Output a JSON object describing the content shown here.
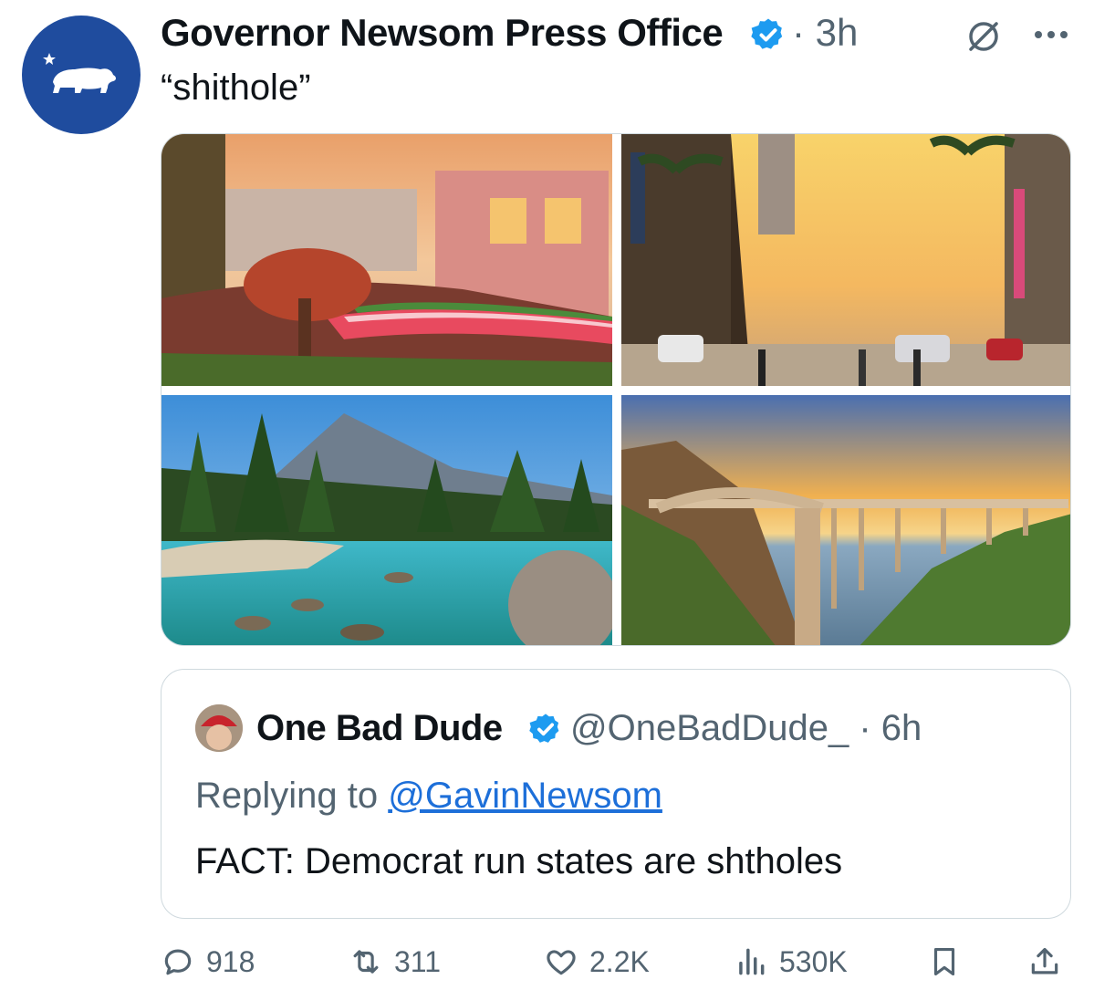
{
  "post": {
    "author_name": "Governor Newsom Press Office",
    "time": "· 3h",
    "text": "“shithole”"
  },
  "quoted_post": {
    "author_name": "One Bad Dude",
    "handle_time": "@OneBadDude_ · 6h",
    "replying_prefix": "Replying to ",
    "replying_to": "@GavinNewsom",
    "text": "FACT: Democrat run states are shtholes"
  },
  "actions": {
    "replies": "918",
    "reposts": "311",
    "likes": "2.2K",
    "views": "530K"
  },
  "icons": [
    "verified-badge-icon",
    "grok-icon",
    "more-icon",
    "reply-icon",
    "repost-icon",
    "like-icon",
    "views-icon",
    "bookmark-icon",
    "share-icon"
  ],
  "colors": {
    "avatar_bg": "#1f4c9e",
    "verified": "#1d9bf0",
    "link": "#1d6fd9",
    "muted": "#536471"
  }
}
